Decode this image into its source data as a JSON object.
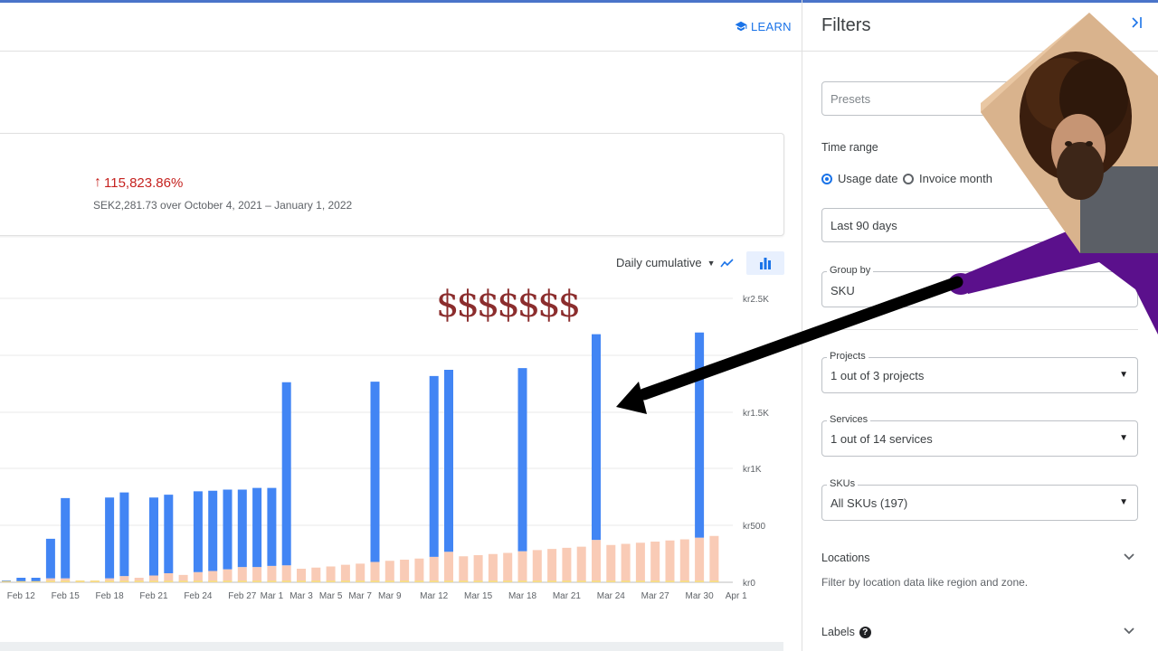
{
  "header": {
    "learn_label": "LEARN"
  },
  "summary": {
    "change_pct": "115,823.86%",
    "change_detail": "SEK2,281.73 over October 4, 2021 – January 1, 2022"
  },
  "chart_controls": {
    "view_label": "Daily cumulative"
  },
  "overlay": {
    "dollars": "$$$$$$$"
  },
  "chart_data": {
    "type": "bar",
    "stacked": true,
    "y_tick_labels": [
      "kr0",
      "kr500",
      "kr1K",
      "kr1.5K",
      "kr2.5K"
    ],
    "x_tick_labels": [
      "Feb 12",
      "Feb 15",
      "Feb 18",
      "Feb 21",
      "Feb 24",
      "Feb 27",
      "Mar 1",
      "Mar 3",
      "Mar 5",
      "Mar 7",
      "Mar 9",
      "Mar 12",
      "Mar 15",
      "Mar 18",
      "Mar 21",
      "Mar 24",
      "Mar 27",
      "Mar 30",
      "Apr 1"
    ],
    "colors": {
      "blue": "#4285f4",
      "peach": "#f9cbb6",
      "gold": "#f7dc8a"
    },
    "bars": [
      {
        "day": "Feb 11",
        "blue": 5,
        "peach": 10
      },
      {
        "day": "Feb 12",
        "blue": 30,
        "peach": 10
      },
      {
        "day": "Feb 13",
        "blue": 30,
        "peach": 10
      },
      {
        "day": "Feb 14",
        "blue": 350,
        "peach": 35
      },
      {
        "day": "Feb 15",
        "blue": 710,
        "peach": 35
      },
      {
        "day": "Feb 16",
        "blue": 0,
        "peach": 15
      },
      {
        "day": "Feb 17",
        "blue": 0,
        "peach": 15
      },
      {
        "day": "Feb 18",
        "blue": 715,
        "peach": 35
      },
      {
        "day": "Feb 19",
        "blue": 740,
        "peach": 55
      },
      {
        "day": "Feb 20",
        "blue": 0,
        "peach": 40
      },
      {
        "day": "Feb 21",
        "blue": 690,
        "peach": 60
      },
      {
        "day": "Feb 22",
        "blue": 695,
        "peach": 80
      },
      {
        "day": "Feb 23",
        "blue": 0,
        "peach": 65
      },
      {
        "day": "Feb 24",
        "blue": 715,
        "peach": 90
      },
      {
        "day": "Feb 25",
        "blue": 710,
        "peach": 100
      },
      {
        "day": "Feb 26",
        "blue": 705,
        "peach": 115
      },
      {
        "day": "Feb 27",
        "blue": 685,
        "peach": 135
      },
      {
        "day": "Feb 28",
        "blue": 700,
        "peach": 135
      },
      {
        "day": "Mar 1",
        "blue": 690,
        "peach": 145
      },
      {
        "day": "Mar 2",
        "blue": 1620,
        "peach": 150
      },
      {
        "day": "Mar 3",
        "blue": 0,
        "peach": 120
      },
      {
        "day": "Mar 4",
        "blue": 0,
        "peach": 130
      },
      {
        "day": "Mar 5",
        "blue": 0,
        "peach": 140
      },
      {
        "day": "Mar 6",
        "blue": 0,
        "peach": 155
      },
      {
        "day": "Mar 7",
        "blue": 0,
        "peach": 165
      },
      {
        "day": "Mar 8",
        "blue": 1595,
        "peach": 180
      },
      {
        "day": "Mar 9",
        "blue": 0,
        "peach": 190
      },
      {
        "day": "Mar 10",
        "blue": 0,
        "peach": 200
      },
      {
        "day": "Mar 11",
        "blue": 0,
        "peach": 210
      },
      {
        "day": "Mar 12",
        "blue": 1600,
        "peach": 225
      },
      {
        "day": "Mar 13",
        "blue": 1610,
        "peach": 270
      },
      {
        "day": "Mar 14",
        "blue": 0,
        "peach": 230
      },
      {
        "day": "Mar 15",
        "blue": 0,
        "peach": 240
      },
      {
        "day": "Mar 16",
        "blue": 0,
        "peach": 250
      },
      {
        "day": "Mar 17",
        "blue": 0,
        "peach": 260
      },
      {
        "day": "Mar 18",
        "blue": 1620,
        "peach": 275
      },
      {
        "day": "Mar 19",
        "blue": 0,
        "peach": 285
      },
      {
        "day": "Mar 20",
        "blue": 0,
        "peach": 295
      },
      {
        "day": "Mar 21",
        "blue": 0,
        "peach": 305
      },
      {
        "day": "Mar 22",
        "blue": 0,
        "peach": 315
      },
      {
        "day": "Mar 23",
        "blue": 1820,
        "peach": 375
      },
      {
        "day": "Mar 24",
        "blue": 0,
        "peach": 330
      },
      {
        "day": "Mar 25",
        "blue": 0,
        "peach": 340
      },
      {
        "day": "Mar 26",
        "blue": 0,
        "peach": 350
      },
      {
        "day": "Mar 27",
        "blue": 0,
        "peach": 360
      },
      {
        "day": "Mar 28",
        "blue": 0,
        "peach": 370
      },
      {
        "day": "Mar 29",
        "blue": 0,
        "peach": 380
      },
      {
        "day": "Mar 30",
        "blue": 1815,
        "peach": 395
      },
      {
        "day": "Mar 31",
        "blue": 0,
        "peach": 410
      }
    ]
  },
  "filters": {
    "title": "Filters",
    "presets_placeholder": "Presets",
    "time_range_label": "Time range",
    "radio_usage": "Usage date",
    "radio_invoice": "Invoice month",
    "time_value": "Last 90 days",
    "group_by_label": "Group by",
    "group_by_value": "SKU",
    "projects_label": "Projects",
    "projects_value": "1 out of 3 projects",
    "services_label": "Services",
    "services_value": "1 out of 14 services",
    "skus_label": "SKUs",
    "skus_value": "All SKUs (197)",
    "locations_label": "Locations",
    "locations_desc": "Filter by location data like region and zone.",
    "labels_label": "Labels"
  }
}
